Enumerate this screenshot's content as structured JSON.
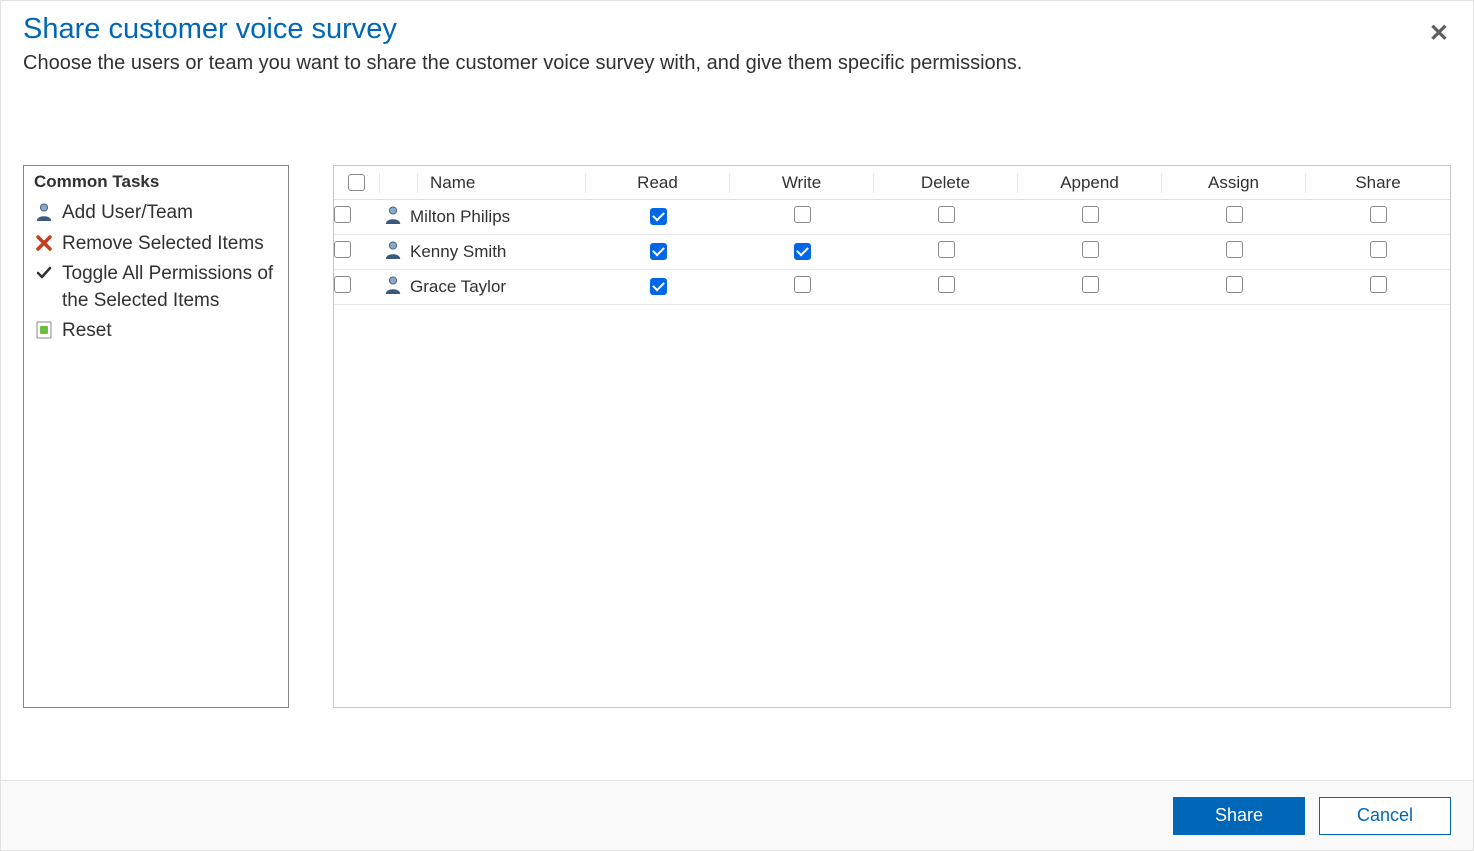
{
  "dialog": {
    "title": "Share customer voice survey",
    "subtitle": "Choose the users or team you want to share the customer voice survey with, and give them specific permissions."
  },
  "tasks": {
    "title": "Common Tasks",
    "items": [
      {
        "label": "Add User/Team",
        "icon": "user-icon"
      },
      {
        "label": "Remove Selected Items",
        "icon": "x-red-icon"
      },
      {
        "label": "Toggle All Permissions of the Selected Items",
        "icon": "check-icon"
      },
      {
        "label": "Reset",
        "icon": "reset-icon"
      }
    ]
  },
  "grid": {
    "columns": {
      "name": "Name",
      "read": "Read",
      "write": "Write",
      "delete": "Delete",
      "append": "Append",
      "assign": "Assign",
      "share": "Share"
    },
    "rows": [
      {
        "name": "Milton Philips",
        "selected": false,
        "read": true,
        "write": false,
        "delete": false,
        "append": false,
        "assign": false,
        "share": false
      },
      {
        "name": "Kenny Smith",
        "selected": false,
        "read": true,
        "write": true,
        "delete": false,
        "append": false,
        "assign": false,
        "share": false
      },
      {
        "name": "Grace Taylor",
        "selected": false,
        "read": true,
        "write": false,
        "delete": false,
        "append": false,
        "assign": false,
        "share": false
      }
    ]
  },
  "footer": {
    "share": "Share",
    "cancel": "Cancel"
  }
}
